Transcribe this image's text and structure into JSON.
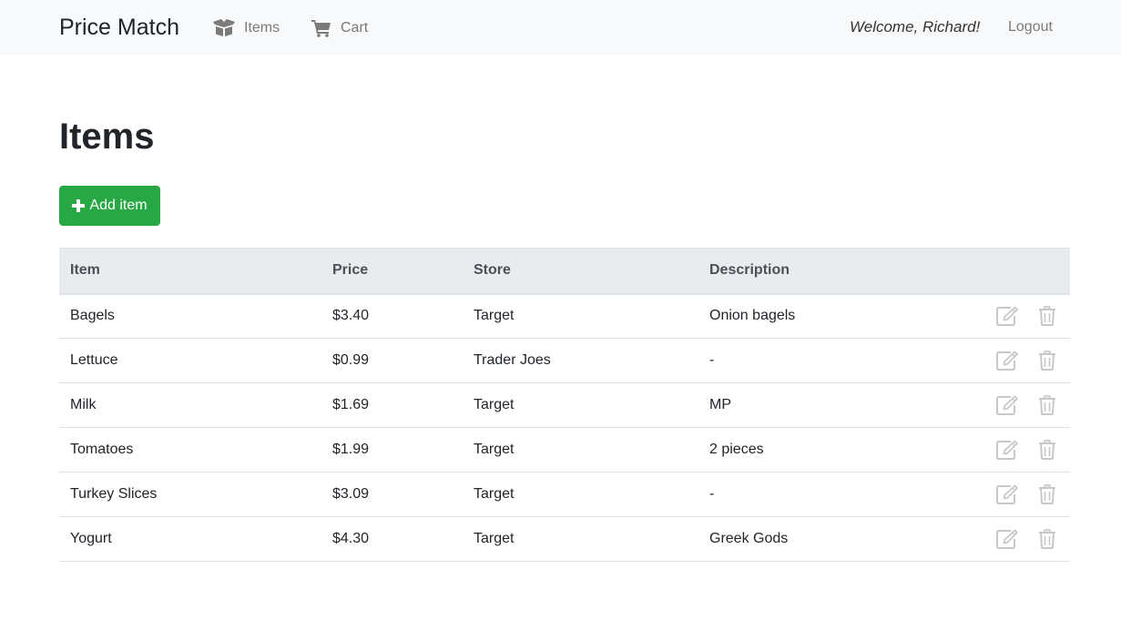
{
  "navbar": {
    "brand": "Price Match",
    "links": [
      {
        "label": "Items",
        "icon": "box-icon"
      },
      {
        "label": "Cart",
        "icon": "cart-icon"
      }
    ],
    "welcome": "Welcome, Richard!",
    "logout": "Logout"
  },
  "page": {
    "title": "Items",
    "add_button": "Add item"
  },
  "table": {
    "headers": [
      "Item",
      "Price",
      "Store",
      "Description"
    ],
    "rows": [
      {
        "item": "Bagels",
        "price": "$3.40",
        "store": "Target",
        "description": "Onion bagels"
      },
      {
        "item": "Lettuce",
        "price": "$0.99",
        "store": "Trader Joes",
        "description": "-"
      },
      {
        "item": "Milk",
        "price": "$1.69",
        "store": "Target",
        "description": "MP"
      },
      {
        "item": "Tomatoes",
        "price": "$1.99",
        "store": "Target",
        "description": "2 pieces"
      },
      {
        "item": "Turkey Slices",
        "price": "$3.09",
        "store": "Target",
        "description": "-"
      },
      {
        "item": "Yogurt",
        "price": "$4.30",
        "store": "Target",
        "description": "Greek Gods"
      }
    ],
    "row_icons": [
      "edit-icon",
      "trash-icon"
    ]
  },
  "colors": {
    "navbar_bg": "#f8f9fa",
    "add_button": "#28a745",
    "table_header_bg": "#e9ecef",
    "action_icon": "#c8c8c8"
  }
}
